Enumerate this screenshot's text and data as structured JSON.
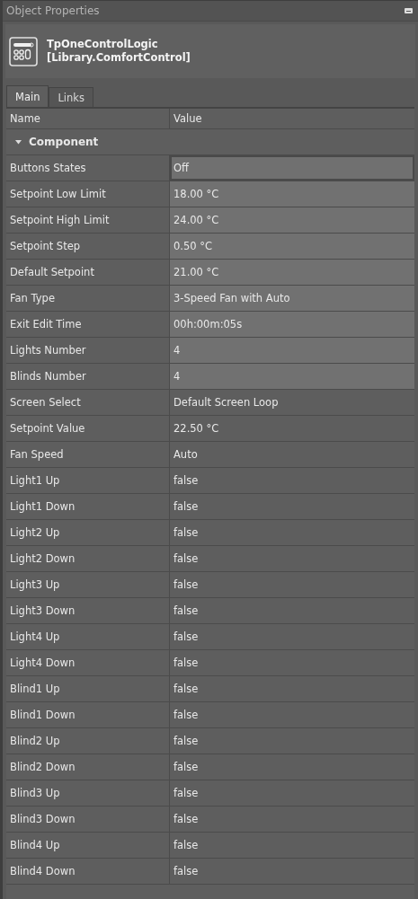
{
  "panel": {
    "title": "Object Properties"
  },
  "object": {
    "name": "TpOneControlLogic",
    "type": "[Library.ComfortControl]"
  },
  "tabs": [
    {
      "label": "Main",
      "selected": true
    },
    {
      "label": "Links",
      "selected": false
    }
  ],
  "table": {
    "columns": [
      "Name",
      "Value"
    ],
    "group": {
      "label": "Component",
      "expanded": true
    },
    "rows": [
      {
        "name": "Buttons States",
        "value": "Off",
        "kind": "editable",
        "selected": true
      },
      {
        "name": "Setpoint Low Limit",
        "value": "18.00 °C",
        "kind": "editable",
        "selected": false
      },
      {
        "name": "Setpoint High Limit",
        "value": "24.00 °C",
        "kind": "editable",
        "selected": false
      },
      {
        "name": "Setpoint Step",
        "value": "0.50 °C",
        "kind": "editable",
        "selected": false
      },
      {
        "name": "Default Setpoint",
        "value": "21.00 °C",
        "kind": "editable",
        "selected": false
      },
      {
        "name": "Fan Type",
        "value": "3-Speed Fan with Auto",
        "kind": "editable",
        "selected": false
      },
      {
        "name": "Exit Edit Time",
        "value": "00h:00m:05s",
        "kind": "editable",
        "selected": false
      },
      {
        "name": "Lights Number",
        "value": "4",
        "kind": "editable",
        "selected": false
      },
      {
        "name": "Blinds Number",
        "value": "4",
        "kind": "editable",
        "selected": false
      },
      {
        "name": "Screen Select",
        "value": "Default Screen Loop",
        "kind": "readonly",
        "selected": false
      },
      {
        "name": "Setpoint Value",
        "value": "22.50 °C",
        "kind": "readonly",
        "selected": false
      },
      {
        "name": "Fan Speed",
        "value": "Auto",
        "kind": "readonly",
        "selected": false
      },
      {
        "name": "Light1 Up",
        "value": "false",
        "kind": "readonly",
        "selected": false
      },
      {
        "name": "Light1 Down",
        "value": "false",
        "kind": "readonly",
        "selected": false
      },
      {
        "name": "Light2 Up",
        "value": "false",
        "kind": "readonly",
        "selected": false
      },
      {
        "name": "Light2 Down",
        "value": "false",
        "kind": "readonly",
        "selected": false
      },
      {
        "name": "Light3 Up",
        "value": "false",
        "kind": "readonly",
        "selected": false
      },
      {
        "name": "Light3 Down",
        "value": "false",
        "kind": "readonly",
        "selected": false
      },
      {
        "name": "Light4 Up",
        "value": "false",
        "kind": "readonly",
        "selected": false
      },
      {
        "name": "Light4 Down",
        "value": "false",
        "kind": "readonly",
        "selected": false
      },
      {
        "name": "Blind1 Up",
        "value": "false",
        "kind": "readonly",
        "selected": false
      },
      {
        "name": "Blind1 Down",
        "value": "false",
        "kind": "readonly",
        "selected": false
      },
      {
        "name": "Blind2 Up",
        "value": "false",
        "kind": "readonly",
        "selected": false
      },
      {
        "name": "Blind2 Down",
        "value": "false",
        "kind": "readonly",
        "selected": false
      },
      {
        "name": "Blind3 Up",
        "value": "false",
        "kind": "readonly",
        "selected": false
      },
      {
        "name": "Blind3 Down",
        "value": "false",
        "kind": "readonly",
        "selected": false
      },
      {
        "name": "Blind4 Up",
        "value": "false",
        "kind": "readonly",
        "selected": false
      },
      {
        "name": "Blind4 Down",
        "value": "false",
        "kind": "readonly",
        "selected": false
      }
    ]
  }
}
